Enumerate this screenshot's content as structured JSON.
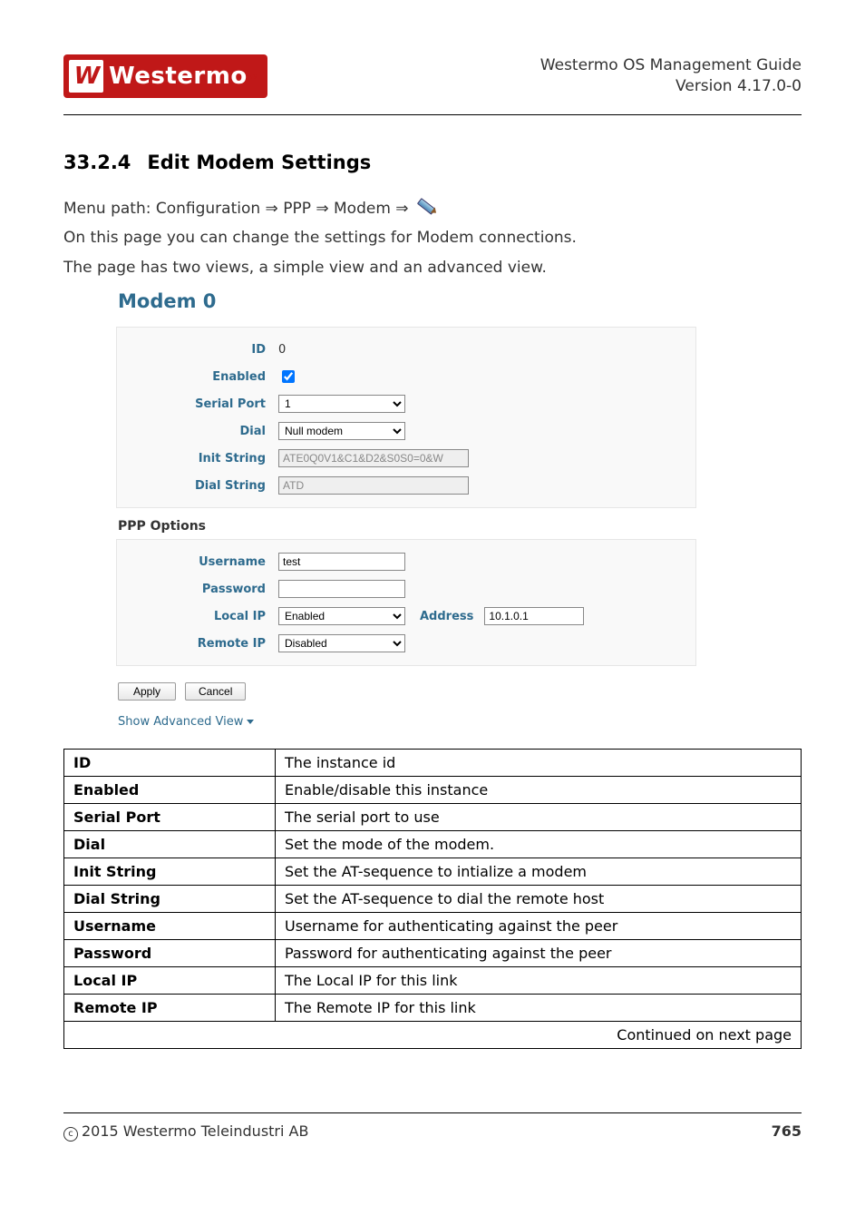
{
  "header": {
    "guide_title": "Westermo OS Management Guide",
    "version": "Version 4.17.0-0",
    "logo_mark": "W",
    "logo_text": "Westermo"
  },
  "section": {
    "number": "33.2.4",
    "title": "Edit Modem Settings"
  },
  "intro": {
    "menu_path_prefix": "Menu path: Configuration ⇒ PPP ⇒ Modem ⇒",
    "line2": "On this page you can change the settings for Modem connections.",
    "line3": "The page has two views, a simple view and an advanced view."
  },
  "form": {
    "title": "Modem 0",
    "fields": {
      "id": {
        "label": "ID",
        "value": "0"
      },
      "enabled": {
        "label": "Enabled",
        "checked": true
      },
      "serial_port": {
        "label": "Serial Port",
        "value": "1"
      },
      "dial": {
        "label": "Dial",
        "value": "Null modem"
      },
      "init_string": {
        "label": "Init String",
        "value": "ATE0Q0V1&C1&D2&S0S0=0&W"
      },
      "dial_string": {
        "label": "Dial String",
        "value": "ATD"
      }
    },
    "ppp_title": "PPP Options",
    "ppp": {
      "username": {
        "label": "Username",
        "value": "test"
      },
      "password": {
        "label": "Password",
        "value": ""
      },
      "local_ip": {
        "label": "Local IP",
        "value": "Enabled"
      },
      "address": {
        "label": "Address",
        "value": "10.1.0.1"
      },
      "remote_ip": {
        "label": "Remote IP",
        "value": "Disabled"
      }
    },
    "buttons": {
      "apply": "Apply",
      "cancel": "Cancel"
    },
    "advanced_link": "Show Advanced View"
  },
  "desc_table": [
    {
      "label": "ID",
      "desc": "The instance id"
    },
    {
      "label": "Enabled",
      "desc": "Enable/disable this instance"
    },
    {
      "label": "Serial Port",
      "desc": "The serial port to use"
    },
    {
      "label": "Dial",
      "desc": "Set the mode of the modem."
    },
    {
      "label": "Init String",
      "desc": "Set the AT-sequence to intialize a modem"
    },
    {
      "label": "Dial String",
      "desc": "Set the AT-sequence to dial the remote host"
    },
    {
      "label": "Username",
      "desc": "Username for authenticating against the peer"
    },
    {
      "label": "Password",
      "desc": "Password for authenticating against the peer"
    },
    {
      "label": "Local IP",
      "desc": "The Local IP for this link"
    },
    {
      "label": "Remote IP",
      "desc": "The Remote IP for this link"
    }
  ],
  "desc_continued": "Continued on next page",
  "footer": {
    "copyright": "2015 Westermo Teleindustri AB",
    "page": "765"
  }
}
